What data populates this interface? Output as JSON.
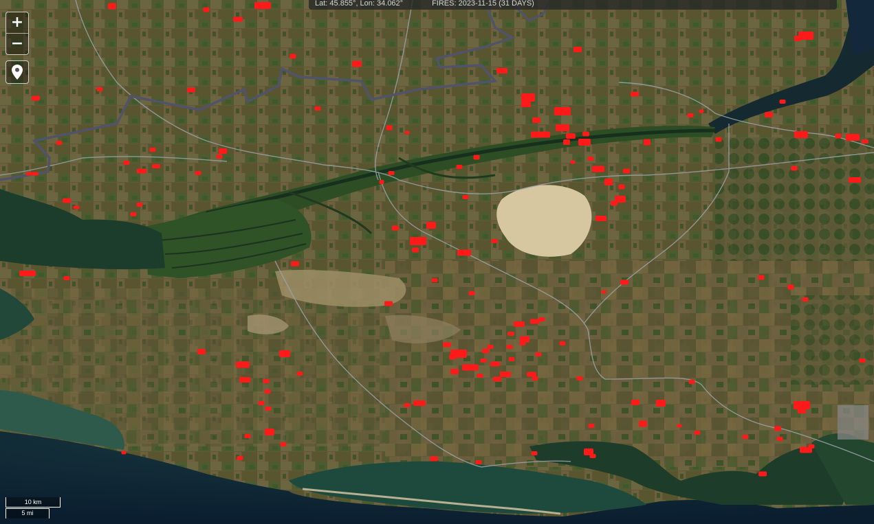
{
  "info_bar": {
    "coords": "Lat: 45.855°, Lon: 34.062°",
    "fires": "FIRES: 2023-11-15 (31 DAYS)"
  },
  "controls": {
    "zoom_in": "+",
    "zoom_out": "−",
    "locate_icon": "map-pin-icon"
  },
  "scale": {
    "km": "10 km",
    "mi": "5 mi"
  },
  "colors": {
    "fire": "#ff1a1a",
    "border": "#4a4e66",
    "water_river": "#1e3a2a",
    "sea": "#0e2a3a",
    "land": "#5d5a36",
    "delta": "#3a5a2a",
    "sand": "#d8c8a0"
  },
  "fire_count_label": "31 DAYS"
}
